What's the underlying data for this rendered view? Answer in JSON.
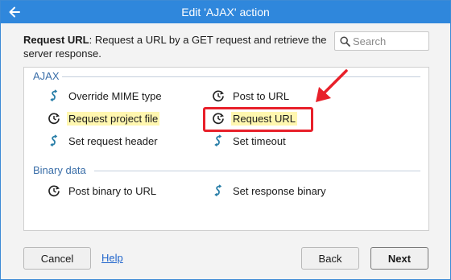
{
  "window": {
    "title": "Edit 'AJAX' action"
  },
  "description": {
    "action_name": "Request URL",
    "text": ": Request a URL by a GET request and retrieve the server response."
  },
  "search": {
    "placeholder": "Search"
  },
  "groups": [
    {
      "label": "AJAX",
      "items": [
        {
          "label": "Override MIME type",
          "icon": "ajax-icon"
        },
        {
          "label": "Post to URL",
          "icon": "clock-icon"
        },
        {
          "label": "Request project file",
          "icon": "clock-icon",
          "highlighted": true
        },
        {
          "label": "Request URL",
          "icon": "clock-icon",
          "selected": true
        },
        {
          "label": "Set request header",
          "icon": "ajax-icon"
        },
        {
          "label": "Set timeout",
          "icon": "ajax-icon"
        }
      ]
    },
    {
      "label": "Binary data",
      "items": [
        {
          "label": "Post binary to URL",
          "icon": "clock-icon"
        },
        {
          "label": "Set response binary",
          "icon": "ajax-icon"
        }
      ]
    }
  ],
  "footer": {
    "cancel_label": "Cancel",
    "help_label": "Help",
    "back_label": "Back",
    "next_label": "Next"
  },
  "colors": {
    "titlebar": "#2f87dc",
    "group_label": "#3a6ea8",
    "highlight": "#fff7b0",
    "selection_box": "#e8202a",
    "annotation_arrow": "#e8202a"
  }
}
